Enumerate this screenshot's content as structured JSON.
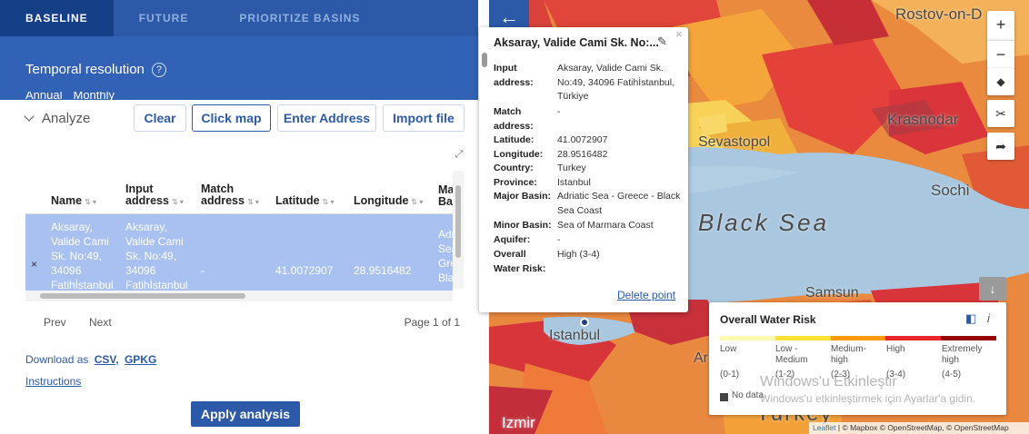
{
  "tabs": [
    {
      "label": "BASELINE",
      "active": true
    },
    {
      "label": "FUTURE",
      "active": false
    },
    {
      "label": "PRIORITIZE BASINS",
      "active": false
    }
  ],
  "temporal": {
    "label": "Temporal resolution",
    "help": "?"
  },
  "radios": {
    "annual": "Annual",
    "monthly": "Monthly"
  },
  "analyze": {
    "label": "Analyze",
    "buttons": {
      "clear": "Clear",
      "click_map": "Click map",
      "enter_address": "Enter Address",
      "import_file": "Import file"
    }
  },
  "table": {
    "headers": {
      "name": "Name",
      "input_address": "Input address",
      "match_address": "Match address",
      "latitude": "Latitude",
      "longitude": "Longitude",
      "major_basin": "Major Ba"
    },
    "row": {
      "remove": "×",
      "name": [
        "Aksaray,",
        "Valide Cami",
        "Sk. No:49,",
        "34096",
        "Fatihİstanbul"
      ],
      "input_address": [
        "Aksaray,",
        "Valide Cami",
        "Sk. No:49,",
        "34096",
        "Fatihİstanbul"
      ],
      "match_address": "-",
      "latitude": "41.0072907",
      "longitude": "28.9516482",
      "major_basin": [
        "Adr",
        "Sea",
        "Gre",
        "Bla"
      ]
    }
  },
  "pager": {
    "prev": "Prev",
    "next": "Next",
    "page": "Page 1 of 1"
  },
  "download": {
    "label": "Download as",
    "csv": "CSV,",
    "gpkg": "GPKG"
  },
  "instructions": "Instructions",
  "apply": "Apply analysis",
  "map": {
    "labels": {
      "rostov": "Rostov-on-D",
      "krasnodar": "Krasnodar",
      "sevastopol": "Sevastopol",
      "sochi": "Sochi",
      "black_sea": "Black Sea",
      "samsun": "Samsun",
      "istanbul": "Istanbul",
      "turkey": "Turkey",
      "izmir": "Izmir",
      "ar": "Ar"
    },
    "controls": {
      "back": "←",
      "zoom_in": "+",
      "zoom_out": "−",
      "collapse": "↓"
    }
  },
  "popup": {
    "title": "Aksaray, Valide Cami Sk. No:...",
    "fields": {
      "input_address_label": "Input address:",
      "input_address": "Aksaray, Valide Cami Sk. No:49, 34096 Fatihİstanbul, Türkiye",
      "match_address_label": "Match address:",
      "match_address": "-",
      "latitude_label": "Latitude:",
      "latitude": "41.0072907",
      "longitude_label": "Longitude:",
      "longitude": "28.9516482",
      "country_label": "Country:",
      "country": "Turkey",
      "province_label": "Province:",
      "province": "Istanbul",
      "major_basin_label": "Major Basin:",
      "major_basin": "Adriatic Sea - Greece - Black Sea Coast",
      "minor_basin_label": "Minor Basin:",
      "minor_basin": "Sea of Marmara Coast",
      "aquifer_label": "Aquifer:",
      "aquifer": "-",
      "overall_label": "Overall Water Risk:",
      "overall": "High (3-4)"
    },
    "delete": "Delete point"
  },
  "legend": {
    "title": "Overall Water Risk",
    "info": "i",
    "categories": [
      {
        "label": "Low",
        "range": "(0-1)",
        "color": "#fff8b0"
      },
      {
        "label": "Low - Medium",
        "range": "(1-2)",
        "color": "#ffe135"
      },
      {
        "label": "Medium-high",
        "range": "(2-3)",
        "color": "#ff9b00"
      },
      {
        "label": "High",
        "range": "(3-4)",
        "color": "#e8252a"
      },
      {
        "label": "Extremely high",
        "range": "(4-5)",
        "color": "#980000"
      }
    ],
    "no_data": "No data"
  },
  "watermark": {
    "line1": "Windows'u Etkinleştir",
    "line2": "Windows'u etkinleştirmek için Ayarlar'a gidin."
  },
  "attribution": {
    "leaflet": "Leaflet",
    "rest": " | © Mapbox © OpenStreetMap, © OpenStreetMap"
  },
  "colors": {
    "primary": "#2c5aa8",
    "tab_active": "#153f86",
    "row_selected": "#a9c1f1"
  }
}
